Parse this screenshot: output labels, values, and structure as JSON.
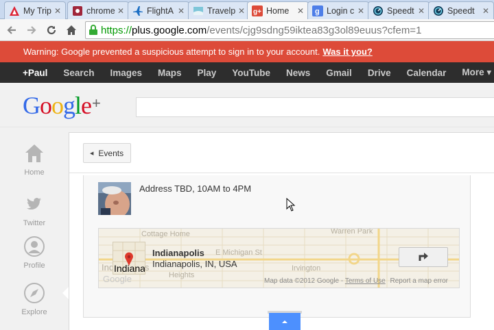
{
  "tabs": [
    {
      "title": "My Trip",
      "icon": "triangle-favicon-icon",
      "active": false
    },
    {
      "title": "chrome",
      "icon": "puzzle-favicon-icon",
      "active": false
    },
    {
      "title": "FlightA",
      "icon": "airplane-favicon-icon",
      "active": false
    },
    {
      "title": "Travelp",
      "icon": "travel-favicon-icon",
      "active": false
    },
    {
      "title": "Home",
      "icon": "google-plus-favicon-icon",
      "active": true
    },
    {
      "title": "Login c",
      "icon": "google-favicon-icon",
      "active": false
    },
    {
      "title": "Speedt",
      "icon": "gauge-favicon-icon",
      "active": false
    },
    {
      "title": "Speedt",
      "icon": "gauge-favicon-icon",
      "active": false
    }
  ],
  "address": {
    "scheme": "https://",
    "host": "plus.google.com",
    "path": "/events/cjg9sdng59iktea83g3ol89euus?cfem=1"
  },
  "warning": {
    "text": "Warning: Google prevented a suspicious attempt to sign in to your account.",
    "link": "Was it you?"
  },
  "gbar": [
    "+Paul",
    "Search",
    "Images",
    "Maps",
    "Play",
    "YouTube",
    "News",
    "Gmail",
    "Drive",
    "Calendar",
    "More ▾"
  ],
  "logo": {
    "text": "Google",
    "plus": "+"
  },
  "leftnav": [
    {
      "label": "Home",
      "icon": "home-icon"
    },
    {
      "label": "Twitter",
      "icon": "twitter-icon"
    },
    {
      "label": "Profile",
      "icon": "profile-icon"
    },
    {
      "label": "Explore",
      "icon": "explore-icon"
    }
  ],
  "content": {
    "back_button": "Events",
    "address_text": "Address TBD, 10AM to 4PM"
  },
  "map": {
    "city": "Indianapolis",
    "state": "Indianapolis, IN, USA",
    "credit": "Map data ©2012 Google - ",
    "terms": "Terms of Use",
    "report": "Report a map error",
    "background_labels": [
      "Cottage Home",
      "Warren Park",
      "E Michigan St",
      "Irvington",
      "Indianapolis",
      "Heights",
      "Google"
    ]
  },
  "colors": {
    "warning_bg": "#dd4b39",
    "gbar_bg": "#2d2d2d",
    "collapse_blue": "#4d90fe",
    "https_green": "#009900"
  }
}
